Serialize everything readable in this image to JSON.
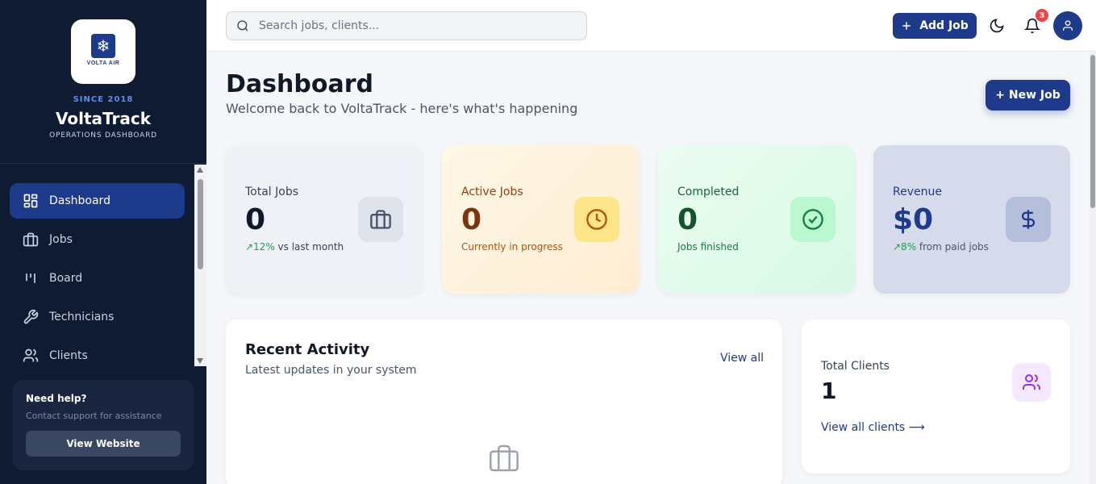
{
  "brand": {
    "logo_text": "VOLTA AIR",
    "since": "SINCE 2018",
    "name": "VoltaTrack",
    "subtitle": "OPERATIONS DASHBOARD"
  },
  "sidebar": {
    "items": [
      {
        "label": "Dashboard",
        "icon": "grid-icon",
        "active": true
      },
      {
        "label": "Jobs",
        "icon": "briefcase-icon",
        "active": false
      },
      {
        "label": "Board",
        "icon": "kanban-icon",
        "active": false
      },
      {
        "label": "Technicians",
        "icon": "wrench-icon",
        "active": false
      },
      {
        "label": "Clients",
        "icon": "users-icon",
        "active": false
      }
    ],
    "help": {
      "title": "Need help?",
      "subtitle": "Contact support for assistance",
      "button": "View Website"
    }
  },
  "header": {
    "search_placeholder": "Search jobs, clients...",
    "add_job": "Add Job",
    "notification_count": "3"
  },
  "main": {
    "title": "Dashboard",
    "subtitle": "Welcome back to VoltaTrack - here's what's happening",
    "new_job": "+ New Job",
    "stats": [
      {
        "label": "Total Jobs",
        "value": "0",
        "trend": "↗12%",
        "note": " vs last month",
        "icon": "briefcase-icon"
      },
      {
        "label": "Active Jobs",
        "value": "0",
        "note": "Currently in progress",
        "icon": "clock-icon"
      },
      {
        "label": "Completed",
        "value": "0",
        "note": "Jobs finished",
        "icon": "check-circle-icon"
      },
      {
        "label": "Revenue",
        "value": "$0",
        "trend": "↗8%",
        "note": " from paid jobs",
        "icon": "dollar-icon"
      }
    ],
    "activity": {
      "title": "Recent Activity",
      "subtitle": "Latest updates in your system",
      "view_all": "View all"
    },
    "clients": {
      "label": "Total Clients",
      "value": "1",
      "link": "View all clients ⟶"
    }
  },
  "colors": {
    "sidebar_bg": "#0f1a33",
    "primary": "#1e3a8a",
    "badge": "#ef4444"
  }
}
